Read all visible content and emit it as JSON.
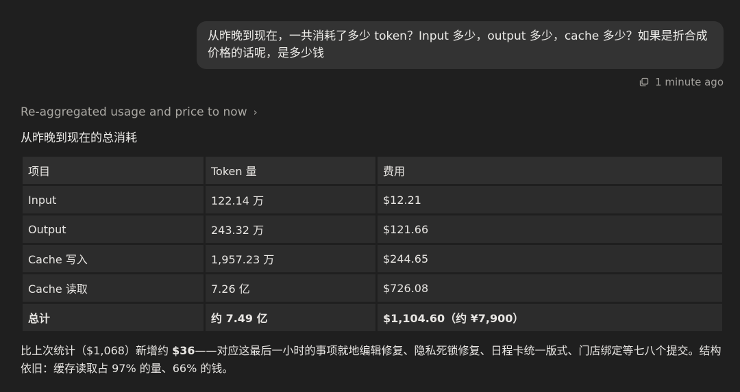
{
  "user_message": {
    "text": "从昨晚到现在，一共消耗了多少 token？Input 多少，output 多少，cache 多少？如果是折合成价格的话呢，是多少钱",
    "timestamp": "1 minute ago",
    "copy_icon": "copy-icon"
  },
  "assistant": {
    "summary_label": "Re-aggregated usage and price to now",
    "summary_chevron": "›",
    "section_title": "从昨晚到现在的总消耗",
    "table": {
      "headers": [
        "项目",
        "Token 量",
        "费用"
      ],
      "rows": [
        [
          "Input",
          "122.14 万",
          "$12.21"
        ],
        [
          "Output",
          "243.32 万",
          "$121.66"
        ],
        [
          "Cache 写入",
          "1,957.23 万",
          "$244.65"
        ],
        [
          "Cache 读取",
          "7.26 亿",
          "$726.08"
        ]
      ],
      "total": [
        "总计",
        "约 7.49 亿",
        "$1,104.60（约 ¥7,900）"
      ]
    },
    "footer": {
      "part1": "比上次统计（$1,068）新增约 ",
      "bold": "$36",
      "part2": "——对应这最后一小时的事项就地编辑修复、隐私死锁修复、日程卡统一版式、门店绑定等七八个提交。结构依旧：缓存读取占 97% 的量、66% 的钱。"
    }
  },
  "colors": {
    "background": "#1f1f1f",
    "bubble": "#333333",
    "cell": "#2c2c2c",
    "muted_text": "#a3a19d"
  }
}
